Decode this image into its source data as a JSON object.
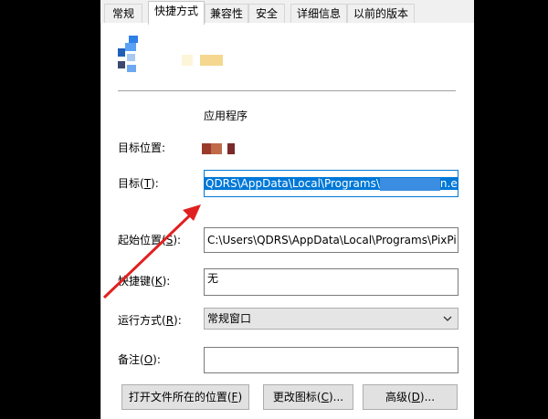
{
  "tabs": [
    "常规",
    "快捷方式",
    "兼容性",
    "安全",
    "详细信息",
    "以前的版本"
  ],
  "type": {
    "label": "应用程序"
  },
  "location": {
    "label": "目标位置:"
  },
  "target": {
    "label_pre": "目标(",
    "label_key": "T",
    "label_post": "):",
    "value_pre": "QDRS\\AppData\\Local\\Programs\\",
    "value_post": "n.exe"
  },
  "start_in": {
    "label_pre": "起始位置(",
    "label_key": "S",
    "label_post": "):",
    "value": "C:\\Users\\QDRS\\AppData\\Local\\Programs\\PixPi"
  },
  "hotkey": {
    "label_pre": "快捷键(",
    "label_key": "K",
    "label_post": "):",
    "value": "无"
  },
  "run": {
    "label_pre": "运行方式(",
    "label_key": "R",
    "label_post": "):",
    "value": "常规窗口"
  },
  "comment": {
    "label_pre": "备注(",
    "label_key": "O",
    "label_post": "):",
    "value": ""
  },
  "buttons": {
    "open_location": {
      "pre": "打开文件所在的位置(",
      "key": "F",
      "post": ")"
    },
    "change_icon": {
      "pre": "更改图标(",
      "key": "C",
      "post": ")..."
    },
    "advanced": {
      "pre": "高级(",
      "key": "D",
      "post": ")..."
    }
  },
  "colors": {
    "selection": "#0078d7",
    "arrow": "#e02020"
  },
  "icons": [
    "app-icon",
    "chevron-down-icon",
    "red-arrow"
  ]
}
